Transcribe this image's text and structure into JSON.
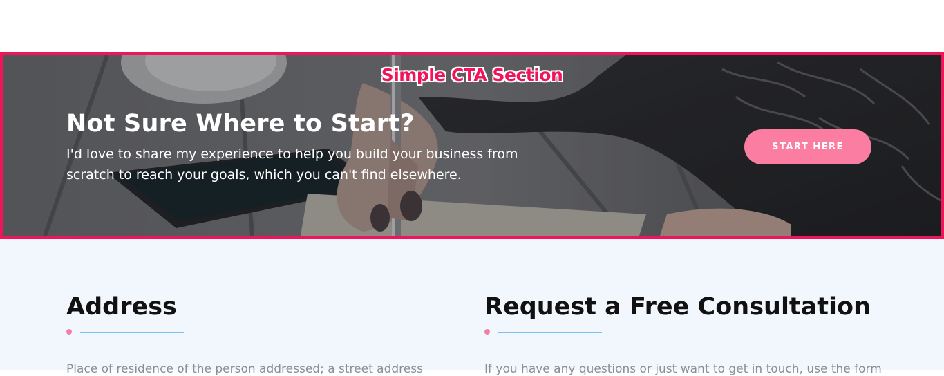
{
  "cta": {
    "section_label": "Simple CTA Section",
    "title": "Not Sure Where to Start?",
    "description": "I'd love to share my experience to help you build your business from scratch to reach your goals, which you can't find elsewhere.",
    "button_label": "START HERE",
    "colors": {
      "highlight_border": "#f0145a",
      "button": "#fb7da1"
    }
  },
  "address": {
    "heading": "Address",
    "text": "Place of residence of the person addressed; a street address"
  },
  "consultation": {
    "heading": "Request a Free Consultation",
    "text": "If you have any questions or just want to get in touch, use the form"
  },
  "colors": {
    "divider_dot": "#f27fa3",
    "divider_line": "#7cc0f2",
    "info_background": "#f1f7fc"
  }
}
